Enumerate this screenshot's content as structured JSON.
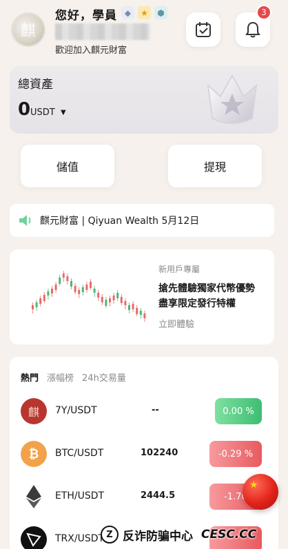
{
  "header": {
    "greeting": "您好，學員",
    "welcome": "歡迎加入麒元財富",
    "notification_count": "3",
    "avatar_glyph": "麒"
  },
  "assets": {
    "title": "總資產",
    "amount": "0",
    "unit": "USDT"
  },
  "actions": {
    "deposit": "儲值",
    "withdraw": "提現"
  },
  "announcement": {
    "text": "麒元財富 | Qiyuan Wealth 5月12日"
  },
  "promo": {
    "tag": "新用戶專屬",
    "title_line1": "搶先體驗獨家代幣優勢",
    "title_line2": "盡享限定發行特權",
    "cta": "立即體驗"
  },
  "market": {
    "tabs": [
      "熱門",
      "漲幅榜",
      "24h交易量"
    ],
    "rows": [
      {
        "pair": "7Y/USDT",
        "price": "--",
        "change": "0.00 %",
        "direction": "flat",
        "icon": "7y-coin-icon"
      },
      {
        "pair": "BTC/USDT",
        "price": "102240",
        "change": "-0.29 %",
        "direction": "down",
        "icon": "btc-coin-icon"
      },
      {
        "pair": "ETH/USDT",
        "price": "2444.5",
        "change": "-1.70",
        "direction": "down",
        "icon": "eth-coin-icon"
      },
      {
        "pair": "TRX/USDT",
        "price": "",
        "change": "",
        "direction": "down",
        "icon": "trx-coin-icon"
      }
    ]
  },
  "watermark": {
    "text": "反诈防骗中心",
    "site": "CESC.CC"
  },
  "colors": {
    "up_green": "#3ebd72",
    "down_red": "#e85a5f",
    "badge_red": "#e5484d"
  }
}
